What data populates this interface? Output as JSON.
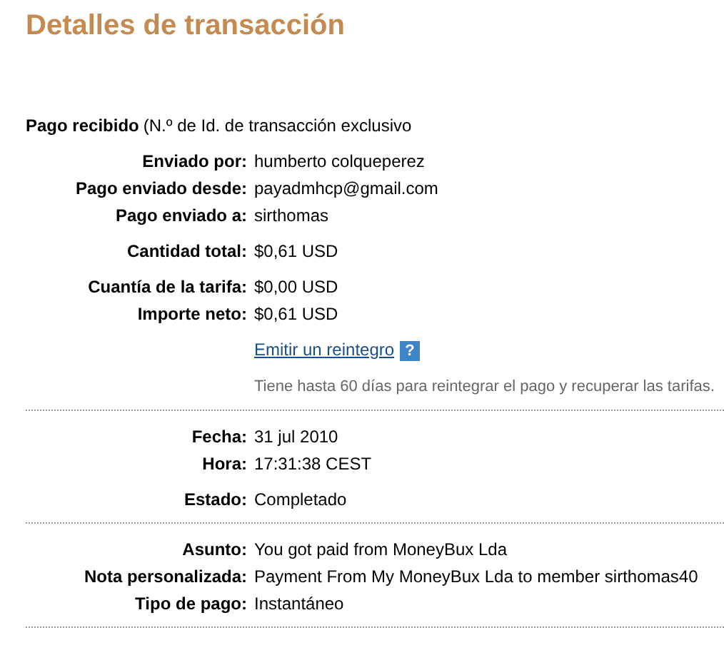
{
  "title": "Detalles de transacción",
  "header": {
    "label": "Pago recibido",
    "text": "(N.º de Id. de transacción exclusivo"
  },
  "sections": [
    {
      "groups": [
        {
          "rows": [
            {
              "kind": "field",
              "label": "Enviado por:",
              "value": "humberto colqueperez"
            },
            {
              "kind": "field",
              "label": "Pago enviado desde:",
              "value": "payadmhcp@gmail.com"
            },
            {
              "kind": "field",
              "label": "Pago enviado a:",
              "value": "sirthomas"
            }
          ]
        },
        {
          "rows": [
            {
              "kind": "field",
              "label": "Cantidad total:",
              "value": "$0,61 USD"
            }
          ]
        },
        {
          "rows": [
            {
              "kind": "field",
              "label": "Cuantía de la tarifa:",
              "value": "$0,00 USD"
            },
            {
              "kind": "field",
              "label": "Importe neto:",
              "value": "$0,61 USD"
            }
          ]
        },
        {
          "rows": [
            {
              "kind": "link",
              "value": "Emitir un reintegro",
              "help": "?"
            }
          ]
        },
        {
          "rows": [
            {
              "kind": "note",
              "value": "Tiene hasta 60 días para reintegrar el pago y recuperar las tarifas."
            }
          ]
        }
      ]
    },
    {
      "groups": [
        {
          "rows": [
            {
              "kind": "field",
              "label": "Fecha:",
              "value": "31 jul 2010"
            },
            {
              "kind": "field",
              "label": "Hora:",
              "value": "17:31:38 CEST"
            }
          ]
        },
        {
          "rows": [
            {
              "kind": "field",
              "label": "Estado:",
              "value": "Completado"
            }
          ]
        }
      ]
    },
    {
      "groups": [
        {
          "rows": [
            {
              "kind": "field",
              "label": "Asunto:",
              "value": "You got paid from MoneyBux Lda"
            },
            {
              "kind": "field",
              "label": "Nota personalizada:",
              "value": "Payment From My MoneyBux Lda to member sirthomas40"
            },
            {
              "kind": "field",
              "label": "Tipo de pago:",
              "value": "Instantáneo"
            }
          ]
        }
      ]
    }
  ]
}
